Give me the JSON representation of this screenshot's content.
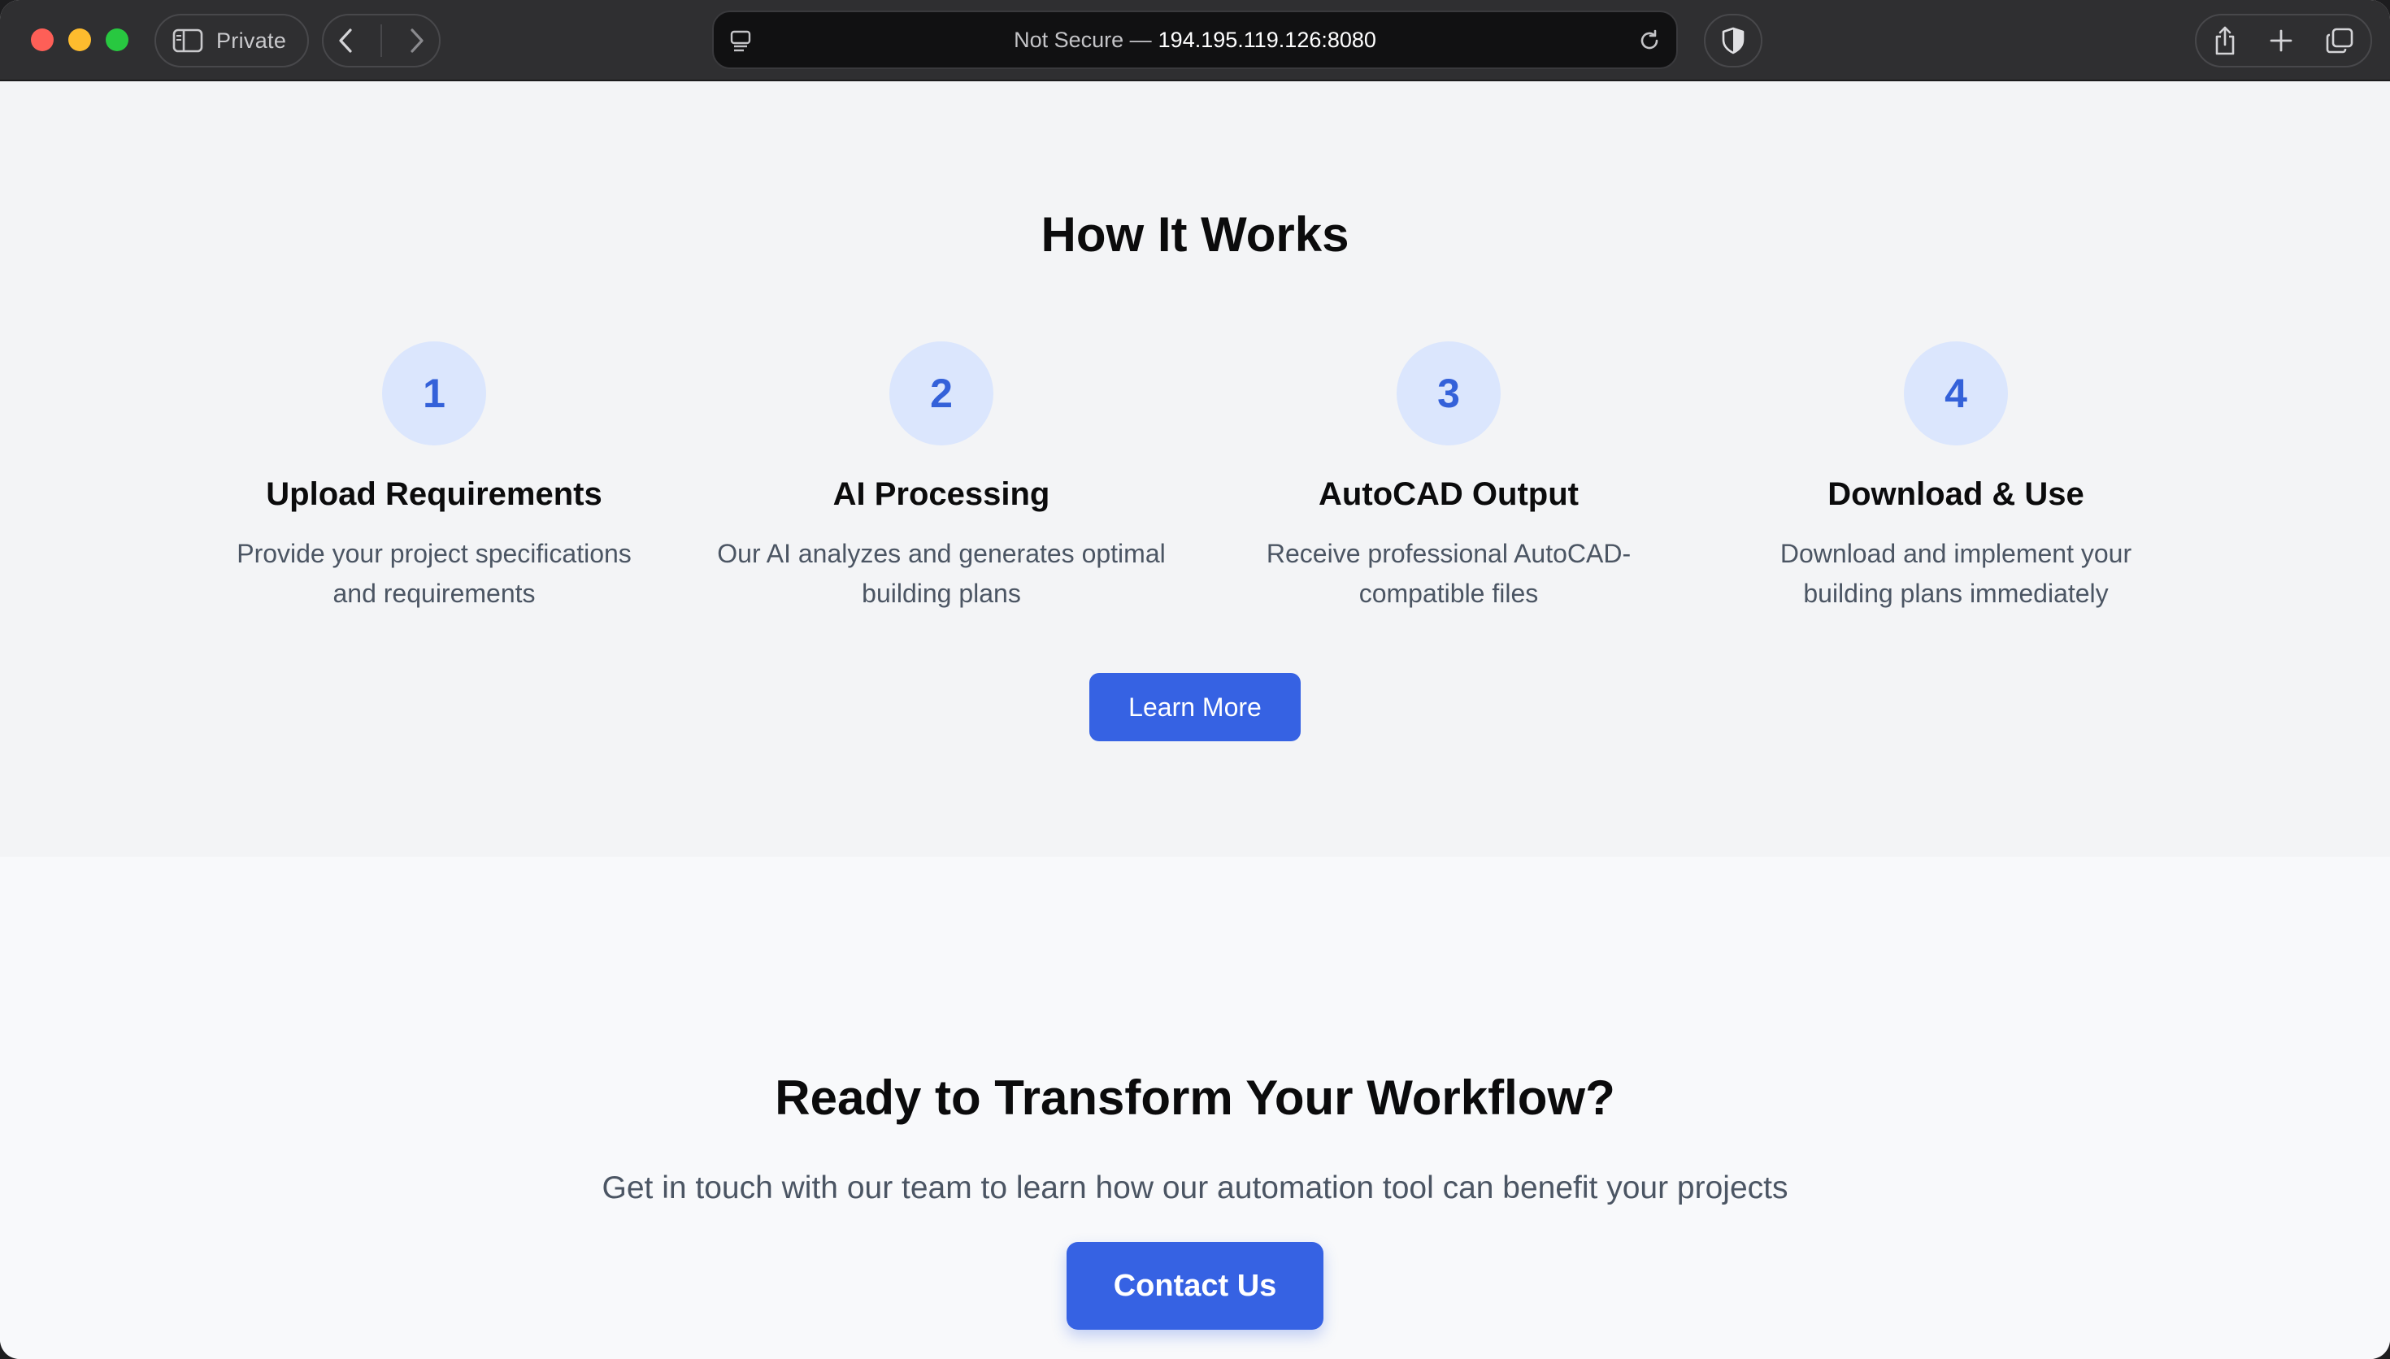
{
  "browser": {
    "private_label": "Private",
    "address_secure_text": "Not Secure —",
    "address_host": "194.195.119.126:8080",
    "icons": [
      "sidebar-icon",
      "back-icon",
      "forward-icon",
      "page-menu-icon",
      "reload-icon",
      "shield-icon",
      "share-icon",
      "new-tab-icon",
      "tabs-overview-icon"
    ]
  },
  "how_it_works": {
    "title": "How It Works",
    "steps": [
      {
        "number": "1",
        "title": "Upload Requirements",
        "description": "Provide your project specifications and requirements"
      },
      {
        "number": "2",
        "title": "AI Processing",
        "description": "Our AI analyzes and generates optimal building plans"
      },
      {
        "number": "3",
        "title": "AutoCAD Output",
        "description": "Receive professional AutoCAD-compatible files"
      },
      {
        "number": "4",
        "title": "Download & Use",
        "description": "Download and implement your building plans immediately"
      }
    ],
    "learn_more_label": "Learn More"
  },
  "cta": {
    "title": "Ready to Transform Your Workflow?",
    "subtitle": "Get in touch with our team to learn how our automation tool can benefit your projects",
    "contact_label": "Contact Us"
  },
  "colors": {
    "accent": "#3662e3",
    "step_circle": "#dbe6fd",
    "step_number": "#3461d9",
    "section_bg": "#f3f4f6",
    "cta_bg": "#f8f9fb"
  }
}
